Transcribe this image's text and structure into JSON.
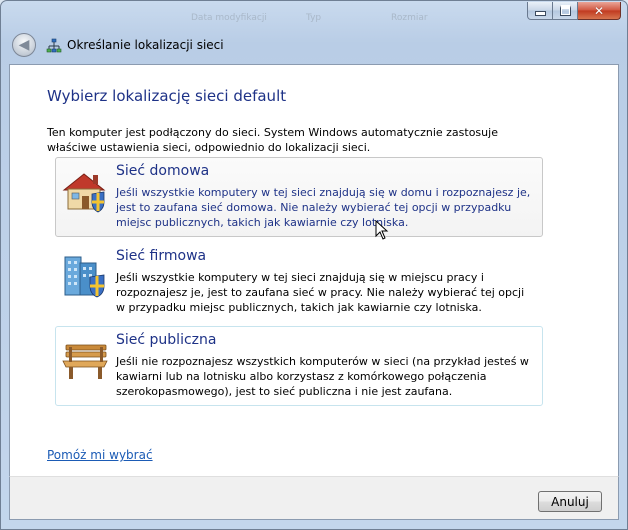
{
  "window": {
    "title": "Określanie lokalizacji sieci",
    "background_ghost": [
      "Data modyfikacji",
      "Typ",
      "Rozmiar"
    ]
  },
  "caption": {
    "close_symbol": "✕"
  },
  "nav": {
    "back_symbol": "◀"
  },
  "main": {
    "heading": "Wybierz lokalizację sieci default",
    "intro": "Ten komputer jest podłączony do sieci. System Windows automatycznie zastosuje właściwe ustawienia sieci, odpowiednio do lokalizacji sieci.",
    "options": [
      {
        "title": "Sieć domowa",
        "description": "Jeśli wszystkie komputery w tej sieci znajdują się w domu i rozpoznajesz je, jest to zaufana sieć domowa. Nie należy wybierać tej opcji w przypadku miejsc publicznych, takich jak kawiarnie czy lotniska.",
        "icon": "home-network-icon",
        "state": "hover"
      },
      {
        "title": "Sieć firmowa",
        "description": "Jeśli wszystkie komputery w tej sieci znajdują się w miejscu pracy i rozpoznajesz je, jest to zaufana sieć w pracy. Nie należy wybierać tej opcji w przypadku miejsc publicznych, takich jak kawiarnie czy lotniska.",
        "icon": "work-network-icon",
        "state": "normal"
      },
      {
        "title": "Sieć publiczna",
        "description": "Jeśli nie rozpoznajesz wszystkich komputerów w sieci (na przykład jesteś w kawiarni lub na lotnisku albo korzystasz z komórkowego połączenia szerokopasmowego), jest to sieć publiczna i nie jest zaufana.",
        "icon": "public-network-bench-icon",
        "state": "focused"
      }
    ],
    "help_link": "Pomóż mi wybrać"
  },
  "footer": {
    "cancel_label": "Anuluj"
  },
  "colors": {
    "heading": "#1e3287",
    "link": "#1b5bb5",
    "hover_border": "#c8c8c8",
    "focus_border": "#c7e4ee"
  }
}
